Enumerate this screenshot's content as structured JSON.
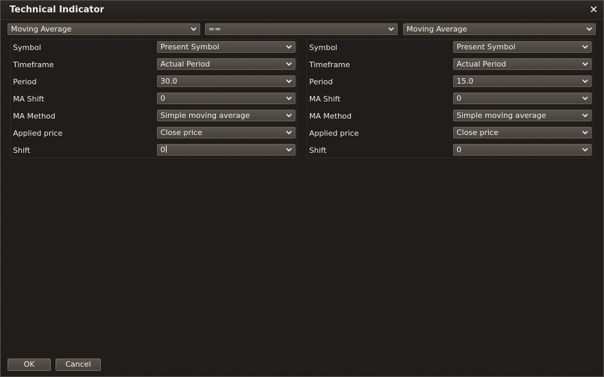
{
  "window": {
    "title": "Technical Indicator",
    "close_glyph": "✕"
  },
  "top_selectors": {
    "left_indicator": "Moving Average",
    "operator": "==",
    "right_indicator": "Moving Average"
  },
  "left_panel": {
    "rows": [
      {
        "label": "Symbol",
        "value": "Present Symbol"
      },
      {
        "label": "Timeframe",
        "value": "Actual Period"
      },
      {
        "label": "Period",
        "value": "30.0"
      },
      {
        "label": "MA Shift",
        "value": "0"
      },
      {
        "label": "MA Method",
        "value": "Simple moving average"
      },
      {
        "label": "Applied price",
        "value": "Close price"
      },
      {
        "label": "Shift",
        "value": "0"
      }
    ]
  },
  "right_panel": {
    "rows": [
      {
        "label": "Symbol",
        "value": "Present Symbol"
      },
      {
        "label": "Timeframe",
        "value": "Actual Period"
      },
      {
        "label": "Period",
        "value": "15.0"
      },
      {
        "label": "MA Shift",
        "value": "0"
      },
      {
        "label": "MA Method",
        "value": "Simple moving average"
      },
      {
        "label": "Applied price",
        "value": "Close price"
      },
      {
        "label": "Shift",
        "value": "0"
      }
    ]
  },
  "buttons": {
    "ok_label": "OK",
    "cancel_label": "Cancel"
  },
  "colors": {
    "background": "#1f1c1a",
    "control": "#4f4943",
    "text": "#f2eee9"
  },
  "icons": {
    "dropdown": "chevron-down-icon",
    "close": "close-icon"
  }
}
